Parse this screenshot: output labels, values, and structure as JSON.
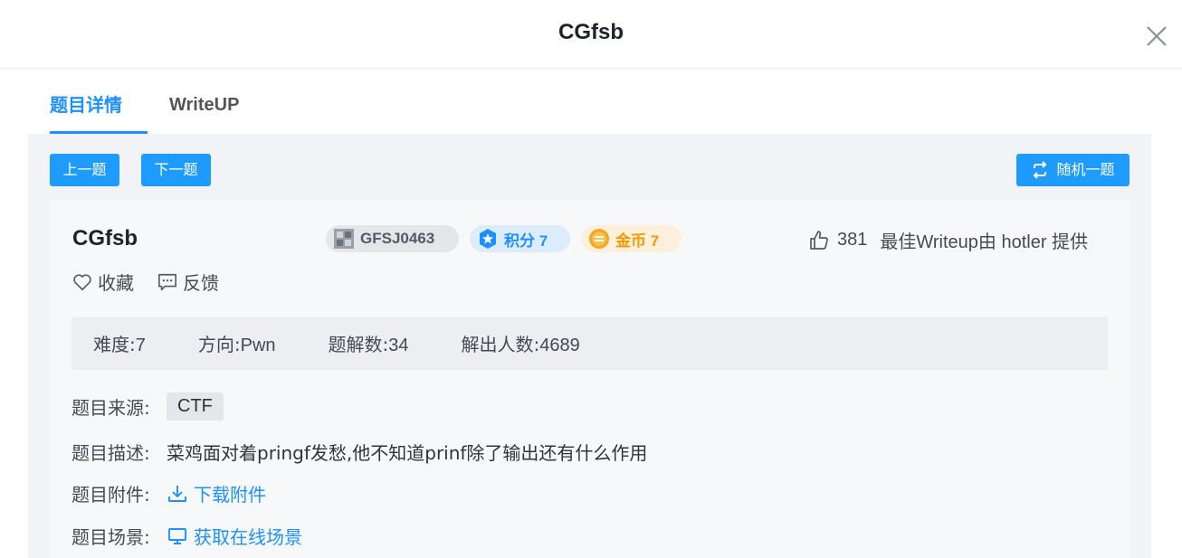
{
  "header": {
    "title": "CGfsb"
  },
  "tabs": [
    {
      "label": "题目详情",
      "active": true
    },
    {
      "label": "WriteUP",
      "active": false
    }
  ],
  "nav": {
    "prev": "上一题",
    "next": "下一题",
    "random": "随机一题"
  },
  "challenge": {
    "title": "CGfsb",
    "code": "GFSJ0463",
    "score": "积分 7",
    "coins": "金币 7",
    "likes": "381",
    "writeup_credit": "最佳Writeup由 hotler 提供",
    "favorite": "收藏",
    "feedback": "反馈"
  },
  "stats": {
    "difficulty_label": "难度:",
    "difficulty": "7",
    "direction_label": "方向:",
    "direction": "Pwn",
    "solves_label": "题解数:",
    "solves": "34",
    "solvers_label": "解出人数:",
    "solvers": "4689"
  },
  "info": {
    "source_label": "题目来源:",
    "source": "CTF",
    "desc_label": "题目描述:",
    "desc": "菜鸡面对着pringf发愁,他不知道prinf除了输出还有什么作用",
    "attachment_label": "题目附件:",
    "attachment_link": "下载附件",
    "scene_label": "题目场景:",
    "scene_link": "获取在线场景"
  },
  "colors": {
    "accent": "#1e90ff",
    "coin": "#f39800",
    "panel": "#f1f3f6"
  },
  "icons": [
    "close-icon",
    "random-icon",
    "code-avatar-icon",
    "score-badge-icon",
    "coin-icon",
    "thumbs-up-icon",
    "heart-icon",
    "feedback-icon",
    "download-icon",
    "monitor-icon"
  ]
}
